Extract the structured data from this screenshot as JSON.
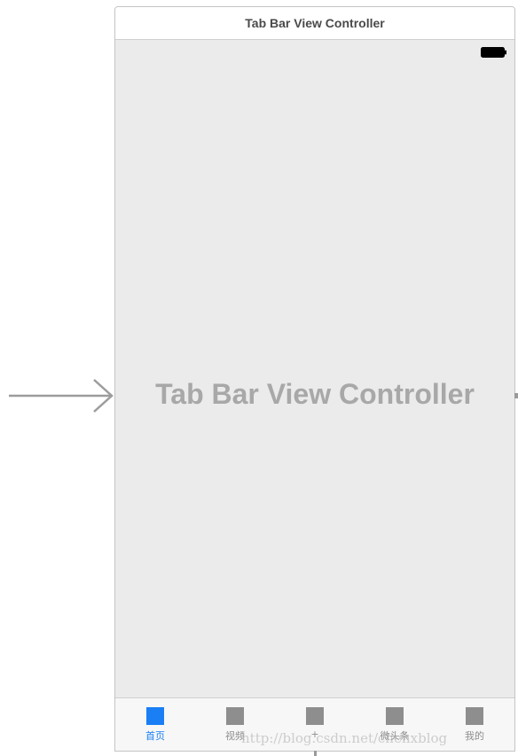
{
  "scene": {
    "header_title": "Tab Bar View Controller",
    "placeholder_title": "Tab Bar View Controller"
  },
  "tab_bar": {
    "items": [
      {
        "label": "首页",
        "selected": true
      },
      {
        "label": "视频",
        "selected": false
      },
      {
        "label": "+",
        "selected": false
      },
      {
        "label": "微头条",
        "selected": false
      },
      {
        "label": "我的",
        "selected": false
      }
    ]
  },
  "watermark": "http://blog.csdn.net/chenxblog",
  "colors": {
    "tint": "#1a7ff5",
    "inactive": "#8e8e8e",
    "scene_bg": "#ebebeb"
  },
  "icons": {
    "entry": "entry-arrow-icon",
    "battery": "battery-icon"
  }
}
